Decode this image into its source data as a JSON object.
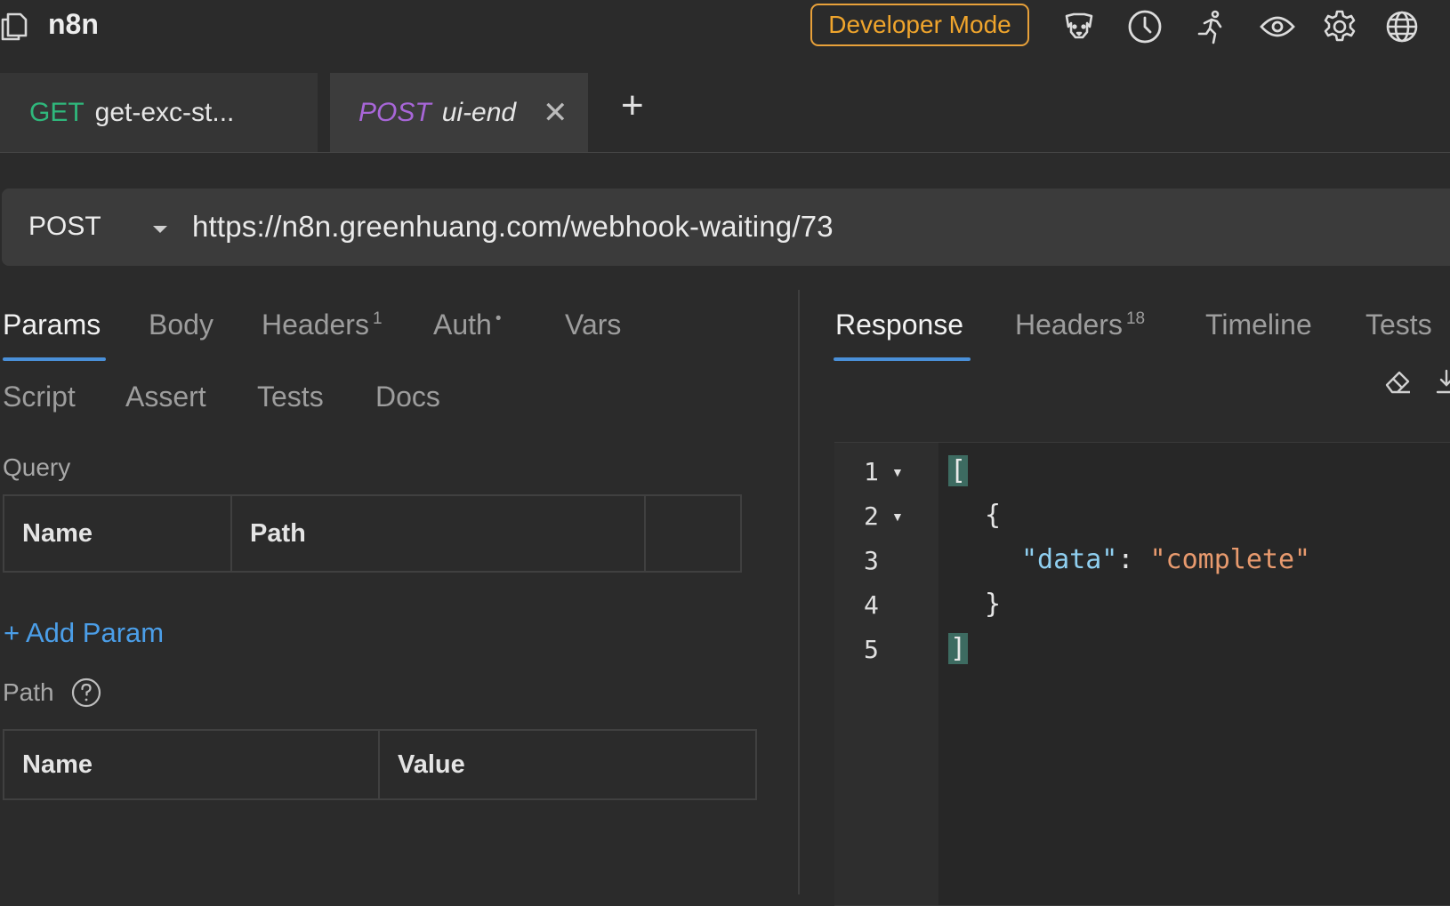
{
  "app": {
    "title": "n8n",
    "developer_mode_label": "Developer Mode"
  },
  "toolbar_icons": [
    "dog-icon",
    "clock-icon",
    "runner-icon",
    "eye-icon",
    "gear-icon",
    "globe-icon"
  ],
  "tabs": [
    {
      "method": "GET",
      "name": "get-exc-st...",
      "method_color": "#2fb87c"
    },
    {
      "method": "POST",
      "name": "ui-end",
      "method_color": "#a866d8"
    }
  ],
  "request": {
    "method": "POST",
    "url": "https://n8n.greenhuang.com/webhook-waiting/73"
  },
  "request_tabs": {
    "row1": [
      {
        "label": "Params",
        "active": true
      },
      {
        "label": "Body"
      },
      {
        "label": "Headers",
        "badge": "1"
      },
      {
        "label": "Auth",
        "badge": "•"
      },
      {
        "label": "Vars"
      }
    ],
    "row2": [
      {
        "label": "Script"
      },
      {
        "label": "Assert"
      },
      {
        "label": "Tests"
      },
      {
        "label": "Docs"
      }
    ]
  },
  "query": {
    "label": "Query",
    "columns": [
      "Name",
      "Path",
      ""
    ],
    "add_label": "+ Add Param"
  },
  "path": {
    "label": "Path",
    "columns": [
      "Name",
      "Value"
    ]
  },
  "response_tabs": [
    {
      "label": "Response",
      "active": true
    },
    {
      "label": "Headers",
      "badge": "18"
    },
    {
      "label": "Timeline"
    },
    {
      "label": "Tests"
    }
  ],
  "response_body": {
    "line_numbers": [
      "1",
      "2",
      "3",
      "4",
      "5"
    ],
    "line1": "[",
    "line2": "{",
    "key": "\"data\"",
    "colon": ": ",
    "value": "\"complete\"",
    "line4": "}",
    "line5": "]"
  },
  "colors": {
    "accent": "#4a90d9",
    "developer_mode": "#f0a52c",
    "link": "#4b9ee8"
  }
}
